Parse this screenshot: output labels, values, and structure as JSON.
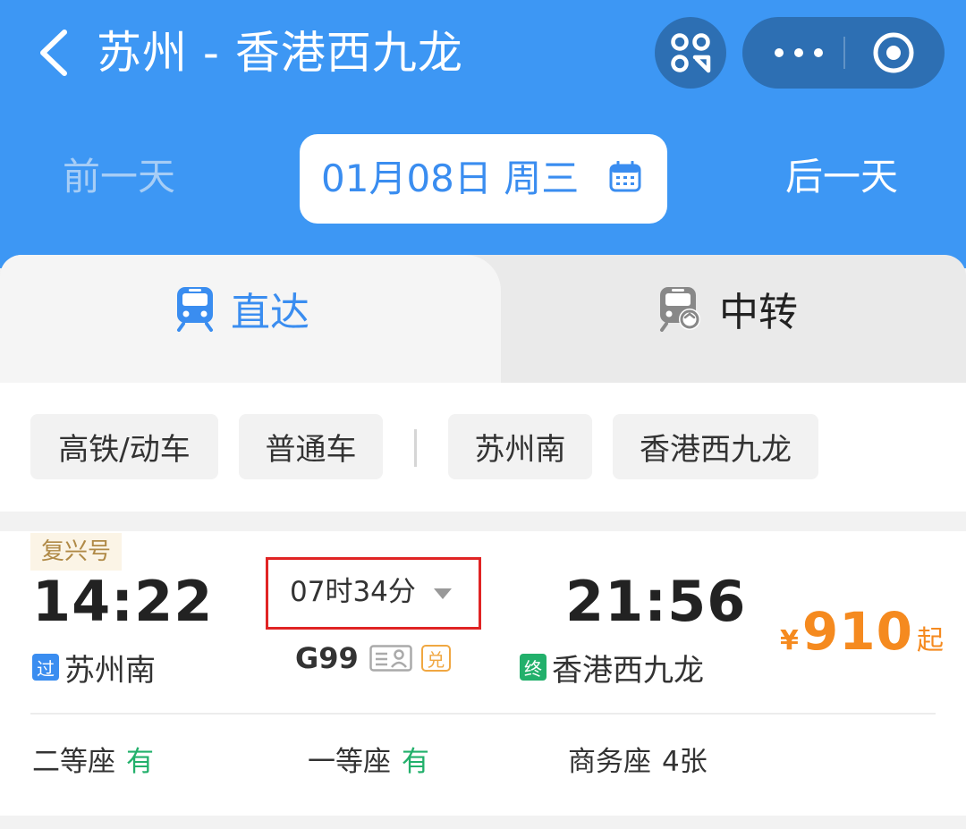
{
  "header": {
    "title": "苏州 - 香港西九龙",
    "prev_day": "前一天",
    "next_day": "后一天",
    "date": "01月08日 周三"
  },
  "tabs": {
    "direct": "直达",
    "transfer": "中转"
  },
  "filters": [
    "高铁/动车",
    "普通车",
    "苏州南",
    "香港西九龙"
  ],
  "train": {
    "type": "复兴号",
    "depart_time": "14:22",
    "depart_station_tag": "过",
    "depart_station": "苏州南",
    "duration": "07时34分",
    "train_no": "G99",
    "exchange_badge": "兑",
    "arrive_time": "21:56",
    "arrive_station_tag": "终",
    "arrive_station": "香港西九龙",
    "price_symbol": "¥",
    "price": "910",
    "price_suffix": "起",
    "seats": [
      {
        "name": "二等座",
        "status": "有"
      },
      {
        "name": "一等座",
        "status": "有"
      },
      {
        "name": "商务座",
        "status": "4张"
      }
    ]
  },
  "colors": {
    "header_blue": "#3d97f4",
    "accent_blue": "#3a8df0",
    "price_orange": "#f58a1f",
    "available_green": "#22b06b",
    "highlight_red": "#e02424"
  }
}
